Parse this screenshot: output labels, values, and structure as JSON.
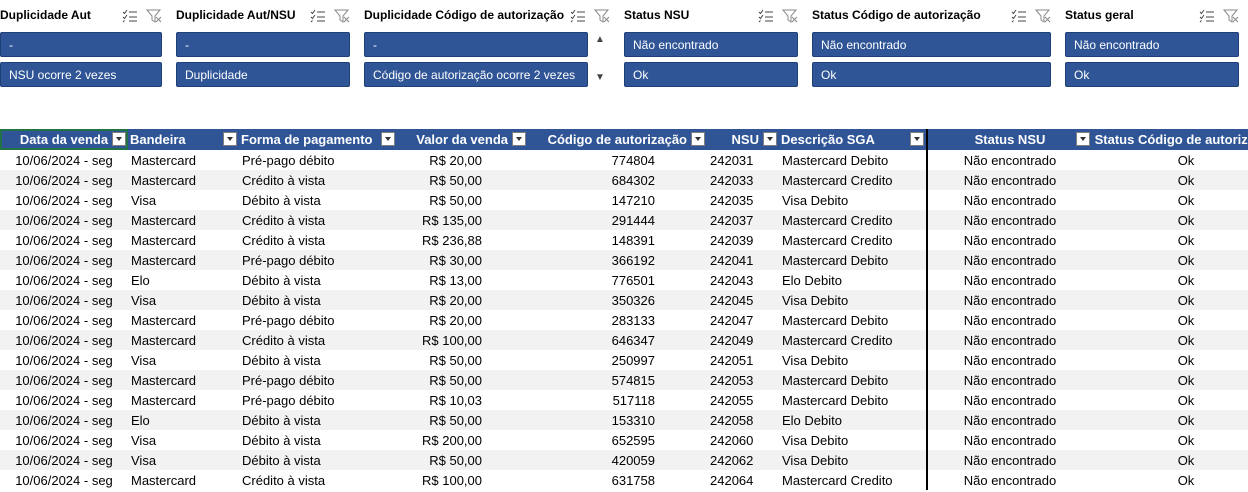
{
  "slicers": [
    {
      "title": "Duplicidade Aut",
      "items": [
        "-",
        "NSU ocorre 2 vezes"
      ]
    },
    {
      "title": "Duplicidade Aut/NSU",
      "items": [
        "-",
        "Duplicidade"
      ]
    },
    {
      "title": "Duplicidade Código de autorização",
      "items": [
        "-",
        "Código de autorização ocorre 2 vezes"
      ],
      "scroll_up": "▲",
      "scroll_down": "▼"
    },
    {
      "title": "Status NSU",
      "items": [
        "Não encontrado",
        "Ok"
      ]
    },
    {
      "title": "Status Código de autorização",
      "items": [
        "Não encontrado",
        "Ok"
      ]
    },
    {
      "title": "Status geral",
      "items": [
        "Não encontrado",
        "Ok"
      ]
    }
  ],
  "colors": {
    "header_bg": "#2f5597",
    "slicer_item_bg": "#2f5597",
    "alt_row": "#f2f2f2"
  },
  "table": {
    "headers": [
      "Data da venda",
      "Bandeira",
      "Forma de pagamento",
      "Valor da venda",
      "Código de autorização",
      "NSU",
      "Descrição SGA",
      "Status NSU",
      "Status Código de autorização"
    ],
    "rows": [
      [
        "10/06/2024 - seg",
        "Mastercard",
        "Pré-pago débito",
        "R$ 20,00",
        "774804",
        "242031",
        "Mastercard Debito",
        "Não encontrado",
        "Ok"
      ],
      [
        "10/06/2024 - seg",
        "Mastercard",
        "Crédito à vista",
        "R$ 50,00",
        "684302",
        "242033",
        "Mastercard Credito",
        "Não encontrado",
        "Ok"
      ],
      [
        "10/06/2024 - seg",
        "Visa",
        "Débito à vista",
        "R$ 50,00",
        "147210",
        "242035",
        "Visa Debito",
        "Não encontrado",
        "Ok"
      ],
      [
        "10/06/2024 - seg",
        "Mastercard",
        "Crédito à vista",
        "R$ 135,00",
        "291444",
        "242037",
        "Mastercard Credito",
        "Não encontrado",
        "Ok"
      ],
      [
        "10/06/2024 - seg",
        "Mastercard",
        "Crédito à vista",
        "R$ 236,88",
        "148391",
        "242039",
        "Mastercard Credito",
        "Não encontrado",
        "Ok"
      ],
      [
        "10/06/2024 - seg",
        "Mastercard",
        "Pré-pago débito",
        "R$ 30,00",
        "366192",
        "242041",
        "Mastercard Debito",
        "Não encontrado",
        "Ok"
      ],
      [
        "10/06/2024 - seg",
        "Elo",
        "Débito à vista",
        "R$ 13,00",
        "776501",
        "242043",
        "Elo Debito",
        "Não encontrado",
        "Ok"
      ],
      [
        "10/06/2024 - seg",
        "Visa",
        "Débito à vista",
        "R$ 20,00",
        "350326",
        "242045",
        "Visa Debito",
        "Não encontrado",
        "Ok"
      ],
      [
        "10/06/2024 - seg",
        "Mastercard",
        "Pré-pago débito",
        "R$ 20,00",
        "283133",
        "242047",
        "Mastercard Debito",
        "Não encontrado",
        "Ok"
      ],
      [
        "10/06/2024 - seg",
        "Mastercard",
        "Crédito à vista",
        "R$ 100,00",
        "646347",
        "242049",
        "Mastercard Credito",
        "Não encontrado",
        "Ok"
      ],
      [
        "10/06/2024 - seg",
        "Visa",
        "Débito à vista",
        "R$ 50,00",
        "250997",
        "242051",
        "Visa Debito",
        "Não encontrado",
        "Ok"
      ],
      [
        "10/06/2024 - seg",
        "Mastercard",
        "Pré-pago débito",
        "R$ 50,00",
        "574815",
        "242053",
        "Mastercard Debito",
        "Não encontrado",
        "Ok"
      ],
      [
        "10/06/2024 - seg",
        "Mastercard",
        "Pré-pago débito",
        "R$ 10,03",
        "517118",
        "242055",
        "Mastercard Debito",
        "Não encontrado",
        "Ok"
      ],
      [
        "10/06/2024 - seg",
        "Elo",
        "Débito à vista",
        "R$ 50,00",
        "153310",
        "242058",
        "Elo Debito",
        "Não encontrado",
        "Ok"
      ],
      [
        "10/06/2024 - seg",
        "Visa",
        "Débito à vista",
        "R$ 200,00",
        "652595",
        "242060",
        "Visa Debito",
        "Não encontrado",
        "Ok"
      ],
      [
        "10/06/2024 - seg",
        "Visa",
        "Débito à vista",
        "R$ 50,00",
        "420059",
        "242062",
        "Visa Debito",
        "Não encontrado",
        "Ok"
      ],
      [
        "10/06/2024 - seg",
        "Mastercard",
        "Crédito à vista",
        "R$ 100,00",
        "631758",
        "242064",
        "Mastercard Credito",
        "Não encontrado",
        "Ok"
      ]
    ]
  }
}
